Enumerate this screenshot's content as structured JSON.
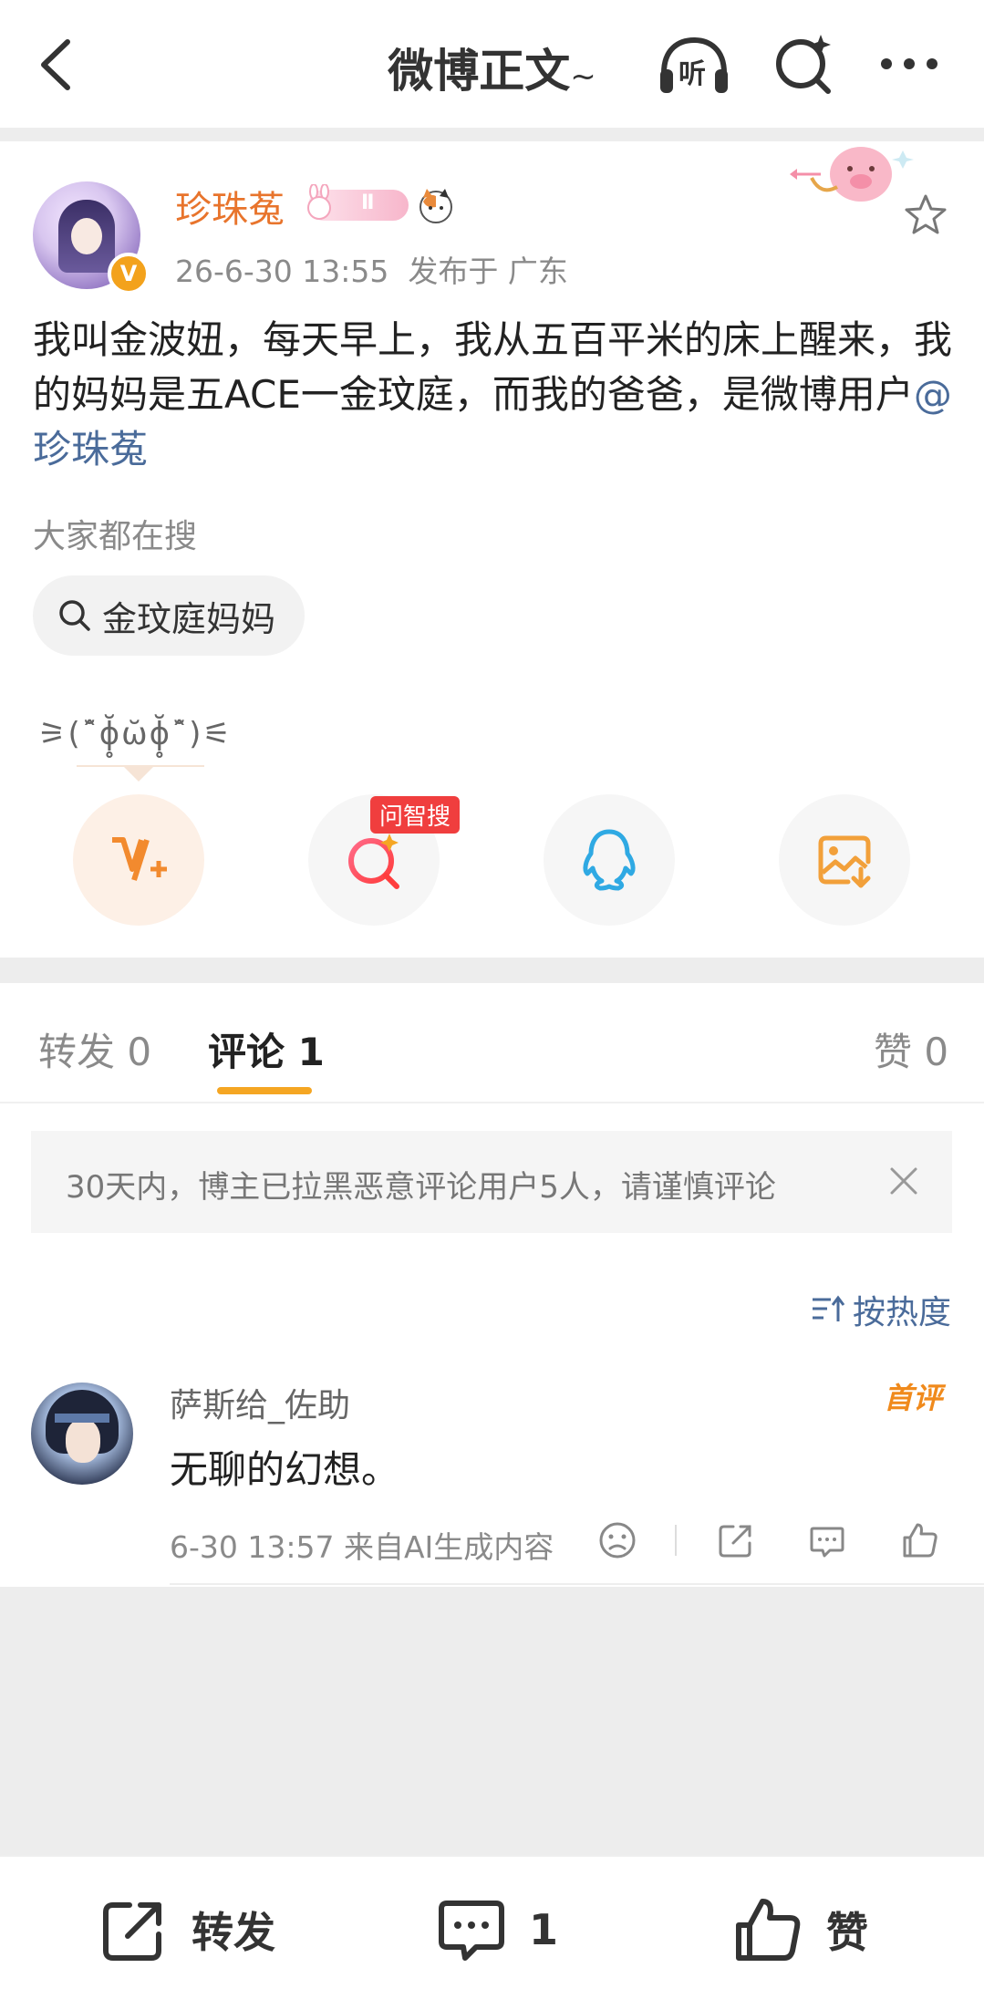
{
  "header": {
    "title": "微博正文",
    "tilde": "~",
    "listen_label": "听"
  },
  "post": {
    "username": "珍珠菟",
    "badge_roman": "Ⅱ",
    "verified_mark": "V",
    "time": "26-6-30 13:55",
    "location": "发布于 广东",
    "content_text": "我叫金波妞，每天早上，我从五百平米的床上醒来，我的妈妈是五ACE一金玟庭，而我的爸爸，是微博用户",
    "mention": "@珍珠菟",
    "search_hint": "大家都在搜",
    "search_chip": "金玟庭妈妈",
    "kaomoji": "⚞(ˆ̆ɸ̥̆ω̆ɸ̥̆ˆ̆)⚟",
    "zhisou_tag": "问智搜"
  },
  "tabs": {
    "repost": "转发 0",
    "comment": "评论 1",
    "like": "赞 0"
  },
  "comments": {
    "notice": "30天内，博主已拉黑恶意评论用户5人，请谨慎评论",
    "sort_label": "按热度",
    "items": [
      {
        "name": "萨斯给_佐助",
        "badge": "首评",
        "text": "无聊的幻想。",
        "meta": "6-30 13:57  来自AI生成内容"
      }
    ]
  },
  "bottom": {
    "repost": "转发",
    "comment_count": "1",
    "like": "赞"
  },
  "colors": {
    "accent": "#f5a623",
    "username": "#e8742c",
    "mention": "#4a6b9a",
    "zhisou_tag": "#f03e3e"
  },
  "icons": {
    "back": "chevron-left-icon",
    "listen": "headphones-icon",
    "search_ai": "search-sparkle-icon",
    "more": "more-dots-icon",
    "star": "star-outline-icon",
    "vplus": "v-plus-icon",
    "qq": "qq-penguin-icon",
    "save_image": "image-download-icon"
  }
}
